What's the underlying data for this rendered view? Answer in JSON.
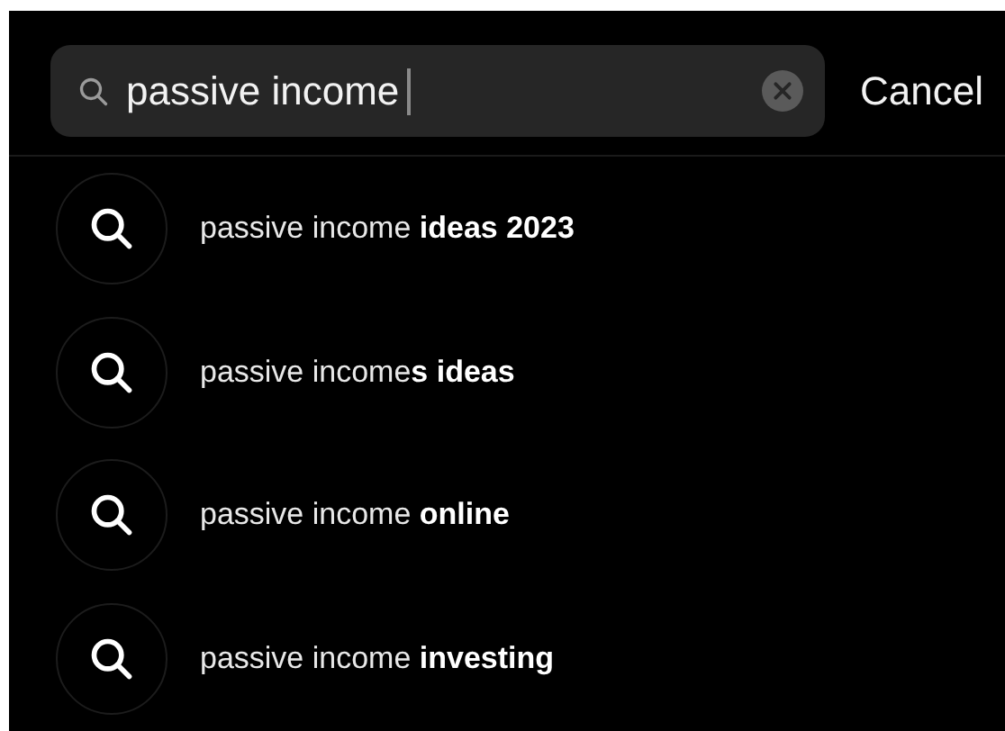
{
  "search": {
    "value": "passive income",
    "cancel": "Cancel"
  },
  "suggestions": [
    {
      "text": "passive income **ideas 2023**"
    },
    {
      "text": "passive income**s ideas**"
    },
    {
      "text": "passive income **online**"
    },
    {
      "text": "passive income **investing**"
    }
  ]
}
